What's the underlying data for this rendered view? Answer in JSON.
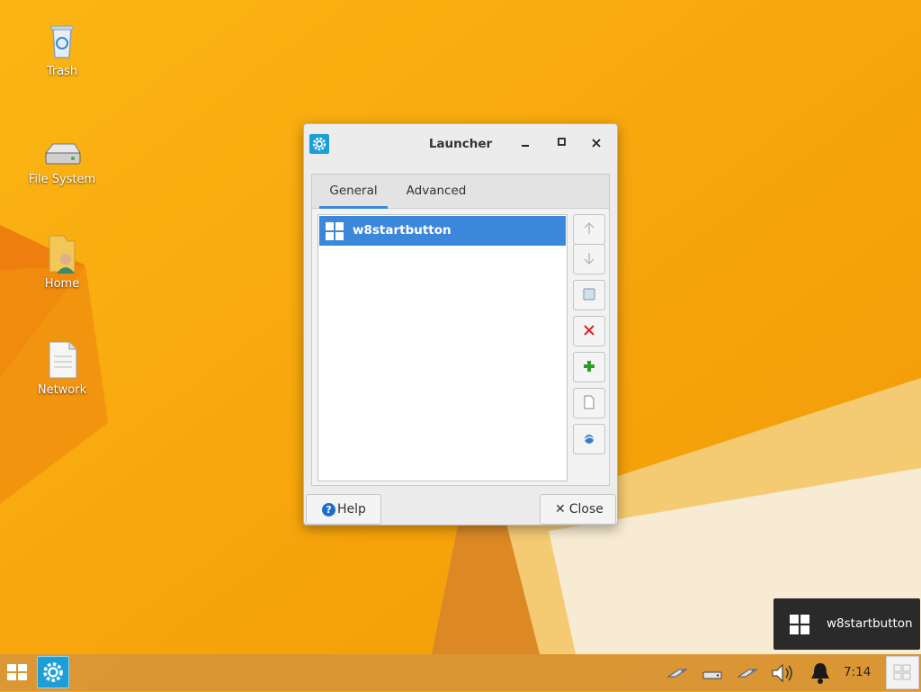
{
  "desktop": {
    "icons": [
      {
        "label": "Trash",
        "icon": "trash-icon"
      },
      {
        "label": "File System",
        "icon": "drive-icon"
      },
      {
        "label": "Home",
        "icon": "home-folder-icon"
      },
      {
        "label": "Network",
        "icon": "network-icon"
      }
    ]
  },
  "window": {
    "title": "Launcher",
    "icon": "gear-icon",
    "controls": [
      "minimize",
      "maximize",
      "close"
    ],
    "tabs": [
      {
        "label": "General",
        "active": true
      },
      {
        "label": "Advanced",
        "active": false
      }
    ],
    "items": [
      {
        "label": "w8startbutton",
        "icon": "windows-logo-icon",
        "selected": true
      }
    ],
    "side_buttons": [
      {
        "icon": "arrow-up-icon",
        "enabled": false
      },
      {
        "icon": "arrow-down-icon",
        "enabled": false
      },
      {
        "icon": "edit-item-icon",
        "enabled": true
      },
      {
        "icon": "delete-icon",
        "enabled": true
      },
      {
        "icon": "add-icon",
        "enabled": true
      },
      {
        "icon": "new-item-icon",
        "enabled": true
      },
      {
        "icon": "launcher-item-icon",
        "enabled": true
      }
    ],
    "help_label": "Help",
    "close_label": "Close"
  },
  "tooltip": {
    "text": "w8startbutton",
    "icon": "windows-logo-icon"
  },
  "taskbar": {
    "clock": "7:14",
    "tray_icons": [
      "network-icon",
      "drive-icon",
      "network-icon",
      "volume-icon",
      "notification-bell-icon"
    ]
  },
  "colors": {
    "wallpaper": "#f7a80d",
    "selection": "#3b87db",
    "accent": "#1b9fd6"
  }
}
